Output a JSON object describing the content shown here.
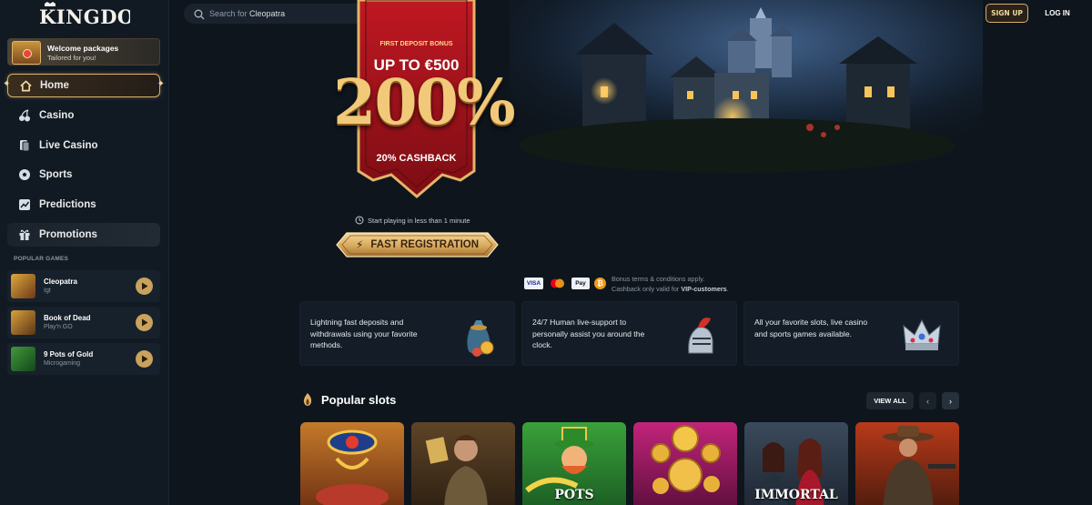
{
  "brand": {
    "logo_text": "KINGDOM"
  },
  "sidebar": {
    "welcome": {
      "title": "Welcome packages",
      "subtitle": "Tailored for you!"
    },
    "nav": [
      {
        "label": "Home",
        "icon": "home-icon",
        "active": true
      },
      {
        "label": "Casino",
        "icon": "cherries-icon"
      },
      {
        "label": "Live Casino",
        "icon": "cards-icon"
      },
      {
        "label": "Sports",
        "icon": "soccer-ball-icon"
      },
      {
        "label": "Predictions",
        "icon": "chart-icon"
      },
      {
        "label": "Promotions",
        "icon": "gift-icon"
      }
    ],
    "popular_label": "POPULAR GAMES",
    "games": [
      {
        "name": "Cleopatra",
        "provider": "Igt"
      },
      {
        "name": "Book of Dead",
        "provider": "Play'n GO"
      },
      {
        "name": "9 Pots of Gold",
        "provider": "Microgaming"
      }
    ]
  },
  "header": {
    "search_prefix": "Search for",
    "search_term": "Cleopatra",
    "signup_label": "SIGN UP",
    "login_label": "LOG IN"
  },
  "hero": {
    "first_deposit": "FIRST DEPOSIT BONUS",
    "up_to": "UP TO €500",
    "percent": "200%",
    "cashback": "20% CASHBACK",
    "start_line": "Start playing in less than 1 minute",
    "cta_label": "FAST REGISTRATION",
    "payments": [
      "VISA",
      "Mastercard",
      "Apple Pay",
      "Bitcoin"
    ],
    "terms_line1": "Bonus terms & conditions apply.",
    "terms_line2_prefix": "Cashback only valid for ",
    "terms_line2_bold": "VIP-customers",
    "terms_line2_suffix": "."
  },
  "features": [
    {
      "text": "Lightning fast deposits and withdrawals using your favorite methods.",
      "icon": "money-bag-icon"
    },
    {
      "text": "24/7 Human live-support to personally assist you around the clock.",
      "icon": "knight-helmet-icon"
    },
    {
      "text": "All your favorite slots, live casino and sports games available.",
      "icon": "crown-icon"
    }
  ],
  "popular": {
    "title": "Popular slots",
    "view_all": "VIEW ALL",
    "slots": [
      {
        "title": "",
        "theme": "egypt"
      },
      {
        "title": "",
        "theme": "adventurer"
      },
      {
        "title": "POTS",
        "theme": "leprechaun"
      },
      {
        "title": "",
        "theme": "coins"
      },
      {
        "title": "IMMORTAL",
        "theme": "vampire"
      },
      {
        "title": "",
        "theme": "western"
      }
    ]
  },
  "colors": {
    "background": "#0e151d",
    "sidebar": "#111a23",
    "gold": "#d6b06a",
    "banner_red": "#a3141c"
  }
}
